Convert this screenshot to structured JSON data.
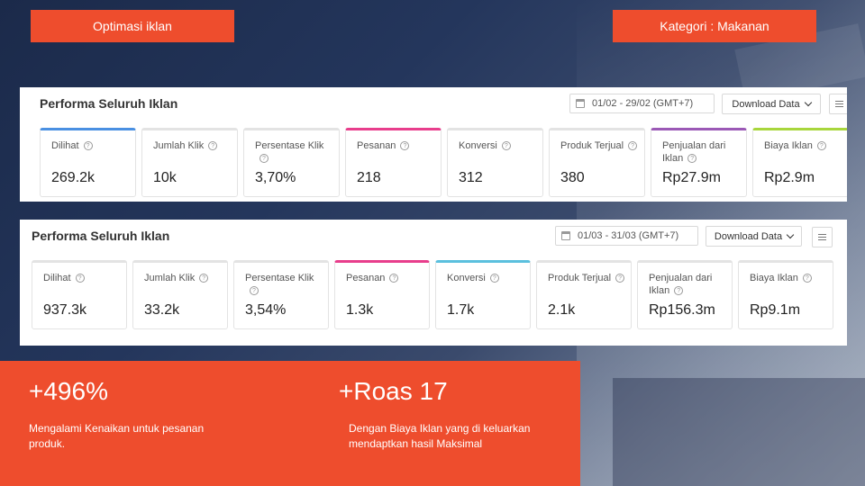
{
  "header": {
    "left_label": "Optimasi iklan",
    "right_label": "Kategori : Makanan"
  },
  "panel1": {
    "title": "Performa Seluruh Iklan",
    "date_range": "01/02 - 29/02 (GMT+7)",
    "download_label": "Download Data",
    "metrics": [
      {
        "label": "Dilihat",
        "value": "269.2k",
        "accent": "#4a90e2"
      },
      {
        "label": "Jumlah Klik",
        "value": "10k",
        "accent": ""
      },
      {
        "label": "Persentase Klik",
        "value": "3,70%",
        "accent": ""
      },
      {
        "label": "Pesanan",
        "value": "218",
        "accent": "#e83e8c"
      },
      {
        "label": "Konversi",
        "value": "312",
        "accent": ""
      },
      {
        "label": "Produk Terjual",
        "value": "380",
        "accent": ""
      },
      {
        "label": "Penjualan dari Iklan",
        "value": "Rp27.9m",
        "accent": "#9b59b6"
      },
      {
        "label": "Biaya Iklan",
        "value": "Rp2.9m",
        "accent": "#a8d63c"
      }
    ]
  },
  "panel2": {
    "title": "Performa Seluruh Iklan",
    "date_range": "01/03 - 31/03 (GMT+7)",
    "download_label": "Download Data",
    "metrics": [
      {
        "label": "Dilihat",
        "value": "937.3k",
        "accent": ""
      },
      {
        "label": "Jumlah Klik",
        "value": "33.2k",
        "accent": ""
      },
      {
        "label": "Persentase Klik",
        "value": "3,54%",
        "accent": ""
      },
      {
        "label": "Pesanan",
        "value": "1.3k",
        "accent": "#e83e8c"
      },
      {
        "label": "Konversi",
        "value": "1.7k",
        "accent": "#5bc0de"
      },
      {
        "label": "Produk Terjual",
        "value": "2.1k",
        "accent": ""
      },
      {
        "label": "Penjualan dari Iklan",
        "value": "Rp156.3m",
        "accent": ""
      },
      {
        "label": "Biaya Iklan",
        "value": "Rp9.1m",
        "accent": ""
      }
    ]
  },
  "summary": {
    "stat1_value": "+496%",
    "stat1_desc": "Mengalami Kenaikan untuk pesanan produk.",
    "stat2_value": "+Roas 17",
    "stat2_desc": "Dengan Biaya Iklan yang di keluarkan mendaptkan hasil Maksimal"
  },
  "colors": {
    "brand": "#ee4d2d"
  }
}
